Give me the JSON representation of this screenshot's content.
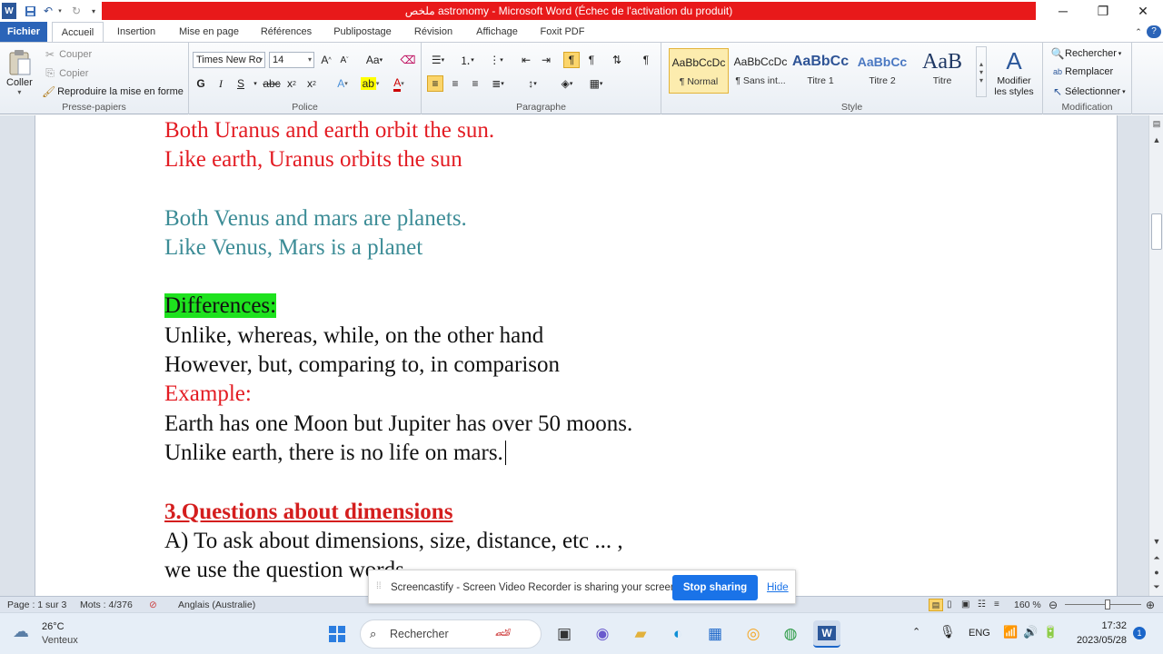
{
  "titlebar": {
    "title": "ملخص astronomy  -  Microsoft Word (Échec de l'activation du produit)",
    "qat": {
      "word_icon": "word-logo-icon",
      "save": "save-icon",
      "undo": "undo-icon",
      "redo": "redo-icon"
    },
    "colors": {
      "bar": "#e8191a"
    }
  },
  "tabs": [
    {
      "label": "Fichier"
    },
    {
      "label": "Accueil"
    },
    {
      "label": "Insertion"
    },
    {
      "label": "Mise en page"
    },
    {
      "label": "Références"
    },
    {
      "label": "Publipostage"
    },
    {
      "label": "Révision"
    },
    {
      "label": "Affichage"
    },
    {
      "label": "Foxit PDF"
    }
  ],
  "ribbon": {
    "clipboard": {
      "paste": "Coller",
      "cut": "Couper",
      "copy": "Copier",
      "format_painter": "Reproduire la mise en forme",
      "label": "Presse-papiers"
    },
    "font": {
      "name": "Times New Ro",
      "size": "14",
      "label": "Police"
    },
    "paragraph": {
      "label": "Paragraphe"
    },
    "styles": {
      "label": "Style",
      "items": [
        {
          "sample": "AaBbCcDc",
          "name": "¶ Normal"
        },
        {
          "sample": "AaBbCcDc",
          "name": "¶ Sans int..."
        },
        {
          "sample": "AaBbCc",
          "name": "Titre 1"
        },
        {
          "sample": "AaBbCc",
          "name": "Titre 2"
        },
        {
          "sample": "AaB",
          "name": "Titre"
        }
      ],
      "modify": "Modifier les styles"
    },
    "editing": {
      "find": "Rechercher",
      "replace": "Remplacer",
      "select": "Sélectionner",
      "label": "Modification"
    }
  },
  "document": {
    "lines": [
      "Both Uranus and earth orbit the sun.",
      "Like earth, Uranus orbits the sun",
      "Both Venus and mars are planets.",
      "Like Venus, Mars is a planet",
      "Differences:",
      " Unlike, whereas, while, on the other hand",
      "However, but, comparing to, in comparison",
      "Example:",
      "Earth has one Moon but Jupiter has over 50 moons.",
      "Unlike earth, there is no life on mars.",
      "3.Questions about dimensions",
      "A) To ask about dimensions, size, distance, etc ... ,",
      "we use the question words"
    ]
  },
  "screencastify": {
    "message": "Screencastify - Screen Video Recorder is sharing your screen.",
    "stop": "Stop sharing",
    "hide": "Hide"
  },
  "statusbar": {
    "page": "Page : 1 sur 3",
    "words": "Mots : 4/376",
    "language": "Anglais (Australie)",
    "zoom": "160 %"
  },
  "taskbar": {
    "weather_temp": "26°C",
    "weather_desc": "Venteux",
    "search": "Rechercher",
    "lang": "ENG",
    "time": "17:32",
    "date": "2023/05/28",
    "badge": "1"
  }
}
